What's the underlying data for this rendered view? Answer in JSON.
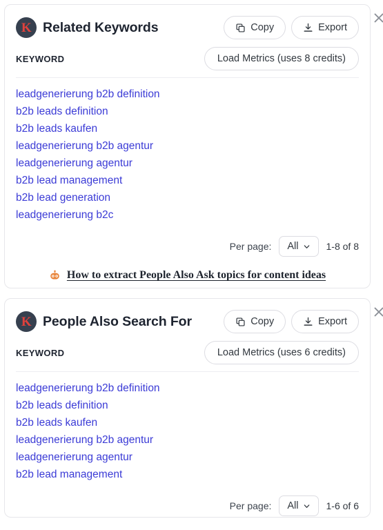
{
  "colors": {
    "link": "#3b3bd6",
    "logo_bg": "#36404f",
    "logo_letter": "#e0413c",
    "robot": "#e8843a",
    "border": "#e6e6ea",
    "text": "#1e2430"
  },
  "cards": [
    {
      "logo_letter": "K",
      "title": "Related Keywords",
      "copy_label": "Copy",
      "export_label": "Export",
      "close_label": "×",
      "column_label": "KEYWORD",
      "load_metrics_label": "Load Metrics (uses 8 credits)",
      "keywords": [
        "leadgenerierung b2b definition",
        "b2b leads definition",
        "b2b leads kaufen",
        "leadgenerierung b2b agentur",
        "leadgenerierung agentur",
        "b2b lead management",
        "b2b lead generation",
        "leadgenerierung b2c"
      ],
      "pagination": {
        "per_page_label": "Per page:",
        "per_page_value": "All",
        "range": "1-8 of 8"
      },
      "footer": {
        "icon": "robot-icon",
        "link_text": "How to extract People Also Ask topics for content ideas"
      }
    },
    {
      "logo_letter": "K",
      "title": "People Also Search For",
      "copy_label": "Copy",
      "export_label": "Export",
      "close_label": "×",
      "column_label": "KEYWORD",
      "load_metrics_label": "Load Metrics (uses 6 credits)",
      "keywords": [
        "leadgenerierung b2b definition",
        "b2b leads definition",
        "b2b leads kaufen",
        "leadgenerierung b2b agentur",
        "leadgenerierung agentur",
        "b2b lead management"
      ],
      "pagination": {
        "per_page_label": "Per page:",
        "per_page_value": "All",
        "range": "1-6 of 6"
      }
    }
  ]
}
